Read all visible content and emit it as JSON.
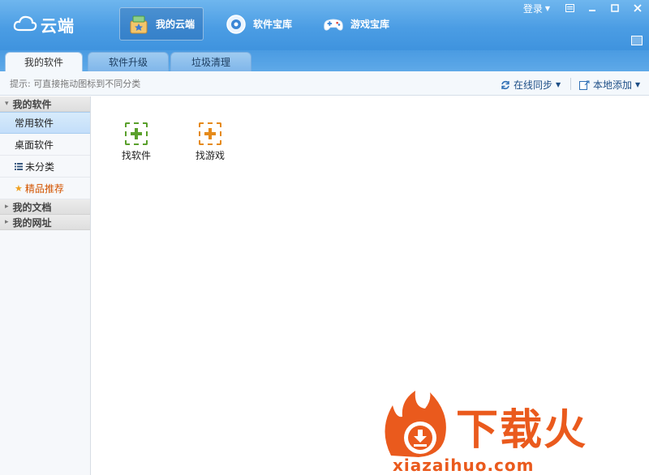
{
  "app": {
    "logo_text": "云端"
  },
  "nav": [
    {
      "label": "我的云端",
      "icon": "box-star-icon",
      "active": true
    },
    {
      "label": "软件宝库",
      "icon": "disc-icon",
      "active": false
    },
    {
      "label": "游戏宝库",
      "icon": "gamepad-icon",
      "active": false
    }
  ],
  "window": {
    "login_label": "登录"
  },
  "tabs": [
    {
      "label": "我的软件",
      "active": true
    },
    {
      "label": "软件升级",
      "active": false
    },
    {
      "label": "垃圾清理",
      "active": false
    }
  ],
  "hintbar": {
    "hint": "提示: 可直接拖动图标到不同分类",
    "sync_label": "在线同步",
    "local_add_label": "本地添加"
  },
  "sidebar": {
    "my_software": "我的软件",
    "items": [
      {
        "label": "常用软件",
        "selected": true
      },
      {
        "label": "桌面软件",
        "selected": false
      },
      {
        "label": "未分类",
        "icon": "list-icon"
      },
      {
        "label": "精品推荐",
        "icon": "star-icon",
        "special": true
      }
    ],
    "my_docs": "我的文档",
    "my_urls": "我的网址"
  },
  "content": {
    "tiles": [
      {
        "label": "找软件",
        "color": "#5aa02c"
      },
      {
        "label": "找游戏",
        "color": "#e58a1a"
      }
    ]
  },
  "watermark": {
    "main": "下载火",
    "sub": "xiazaihuo.com",
    "color": "#ea5a1d"
  }
}
